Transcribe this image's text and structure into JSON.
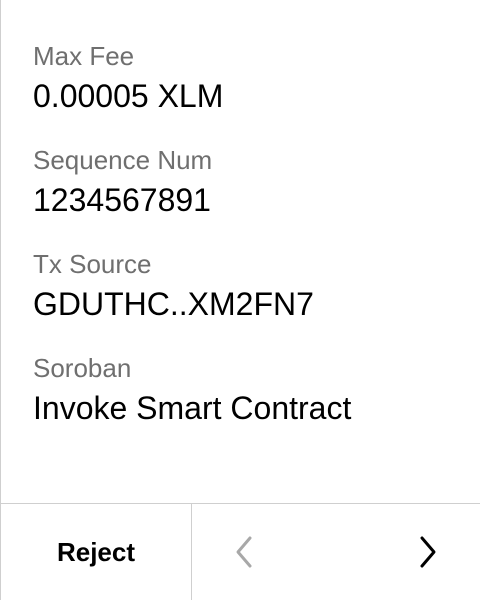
{
  "fields": [
    {
      "label": "Max Fee",
      "value": "0.00005 XLM"
    },
    {
      "label": "Sequence Num",
      "value": "1234567891"
    },
    {
      "label": "Tx Source",
      "value": "GDUTHC..XM2FN7"
    },
    {
      "label": "Soroban",
      "value": "Invoke Smart Contract"
    }
  ],
  "footer": {
    "reject_label": "Reject",
    "prev_icon": "chevron-left-icon",
    "next_icon": "chevron-right-icon"
  },
  "colors": {
    "label": "#6f6f6f",
    "value": "#000000",
    "divider": "#cfcfcf",
    "disabled": "#a8a8a8"
  }
}
